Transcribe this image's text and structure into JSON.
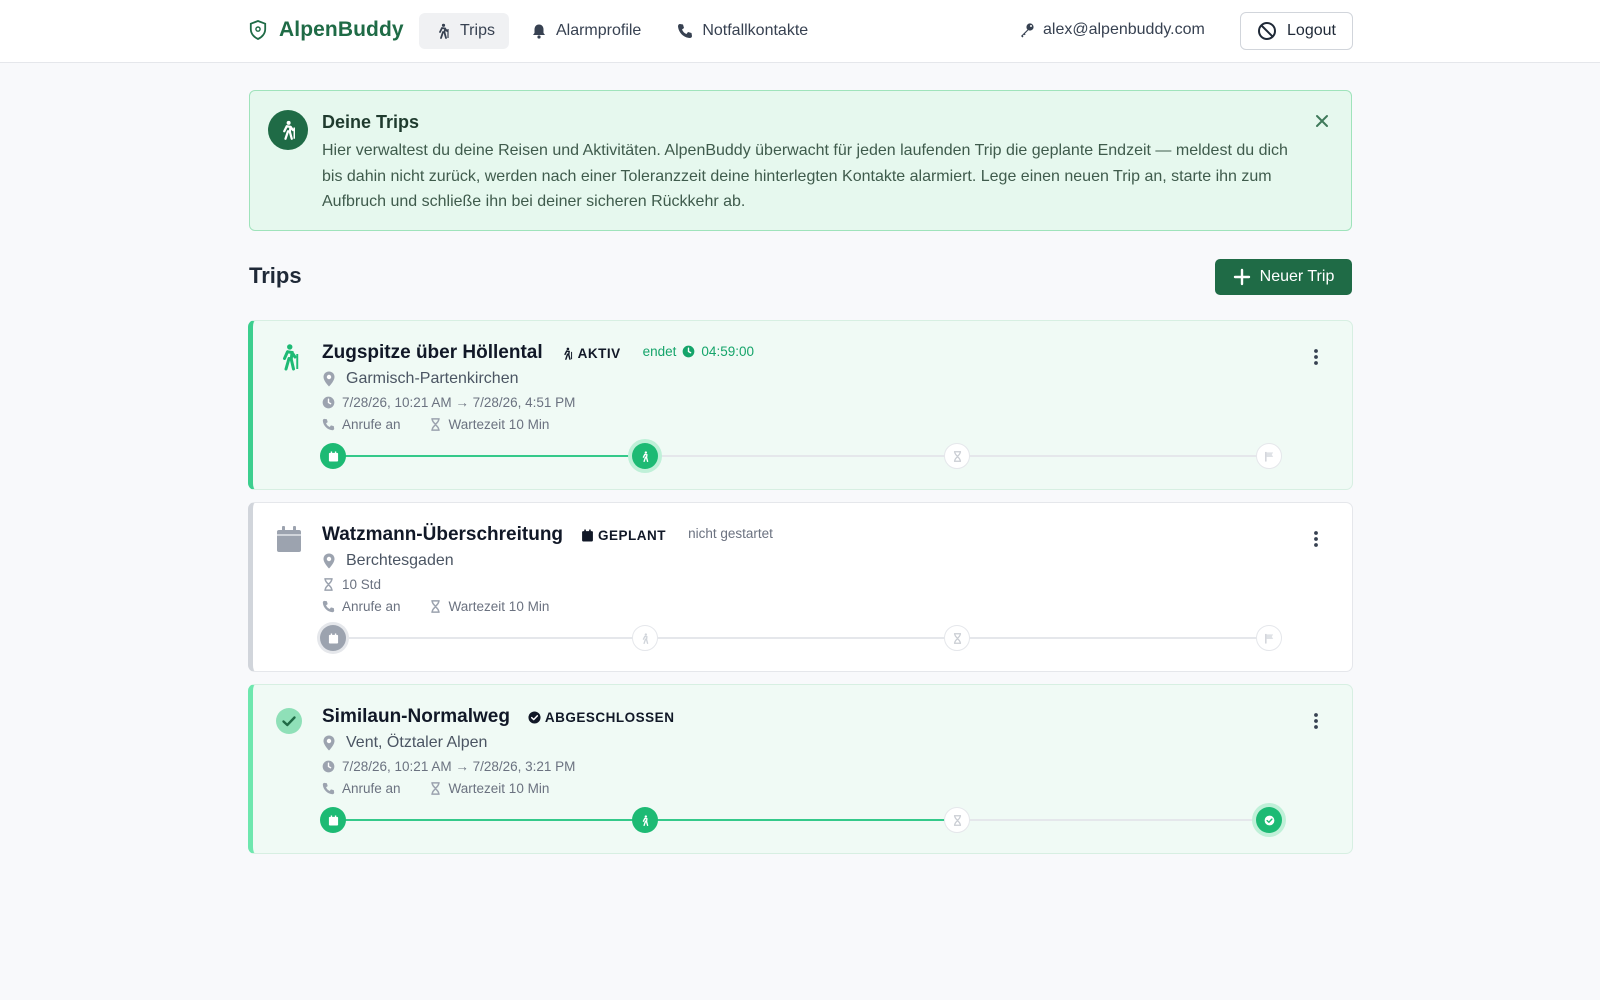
{
  "app": {
    "name": "AlpenBuddy",
    "brand_color": "#1f6b46"
  },
  "nav": [
    {
      "label": "Trips",
      "icon": "hiker-icon",
      "active": true
    },
    {
      "label": "Alarmprofile",
      "icon": "bell-icon",
      "active": false
    },
    {
      "label": "Notfallkontakte",
      "icon": "phone-icon",
      "active": false
    }
  ],
  "user": {
    "email": "alex@alpenbuddy.com",
    "logout_label": "Logout"
  },
  "banner": {
    "title": "Deine Trips",
    "text": "Hier verwaltest du deine Reisen und Aktivitäten. AlpenBuddy überwacht für jeden laufenden Trip die geplante Endzeit — meldest du dich bis dahin nicht zurück, werden nach einer Toleranzzeit deine hinterlegten Kontakte alarmiert. Lege einen neuen Trip an, starte ihn zum Aufbruch und schließe ihn bei deiner sicheren Rückkehr ab.",
    "colors": {
      "background": "#e6f8ee",
      "border": "#9fe3bb"
    }
  },
  "section": {
    "title": "Trips",
    "new_trip_label": "Neuer Trip"
  },
  "trips": [
    {
      "name": "Zugspitze über Höllental",
      "status": "AKTIV",
      "ends_label": "endet",
      "countdown": "04:59:00",
      "location": "Garmisch-Partenkirchen",
      "time": "7/28/26, 10:21 AM → 7/28/26, 4:51 PM",
      "call_label": "Anrufe an",
      "wait_label": "Wartezeit 10 Min",
      "progress_step": 2
    },
    {
      "name": "Watzmann-Überschreitung",
      "status": "GEPLANT",
      "not_started_label": "nicht gestartet",
      "location": "Berchtesgaden",
      "time": "10 Std",
      "call_label": "Anrufe an",
      "wait_label": "Wartezeit 10 Min",
      "progress_step": 1
    },
    {
      "name": "Similaun-Normalweg",
      "status": "ABGESCHLOSSEN",
      "location": "Vent, Ötztaler Alpen",
      "time": "7/28/26, 10:21 AM → 7/28/26, 3:21 PM",
      "call_label": "Anrufe an",
      "wait_label": "Wartezeit 10 Min",
      "progress_step": 4
    }
  ],
  "timeline_steps": [
    "calendar-icon",
    "hiker-icon",
    "hourglass-icon",
    "flag-icon"
  ],
  "colors": {
    "accent": "#1dba74",
    "active_border": "#3ccf8e",
    "text_green": "#15a46a"
  }
}
